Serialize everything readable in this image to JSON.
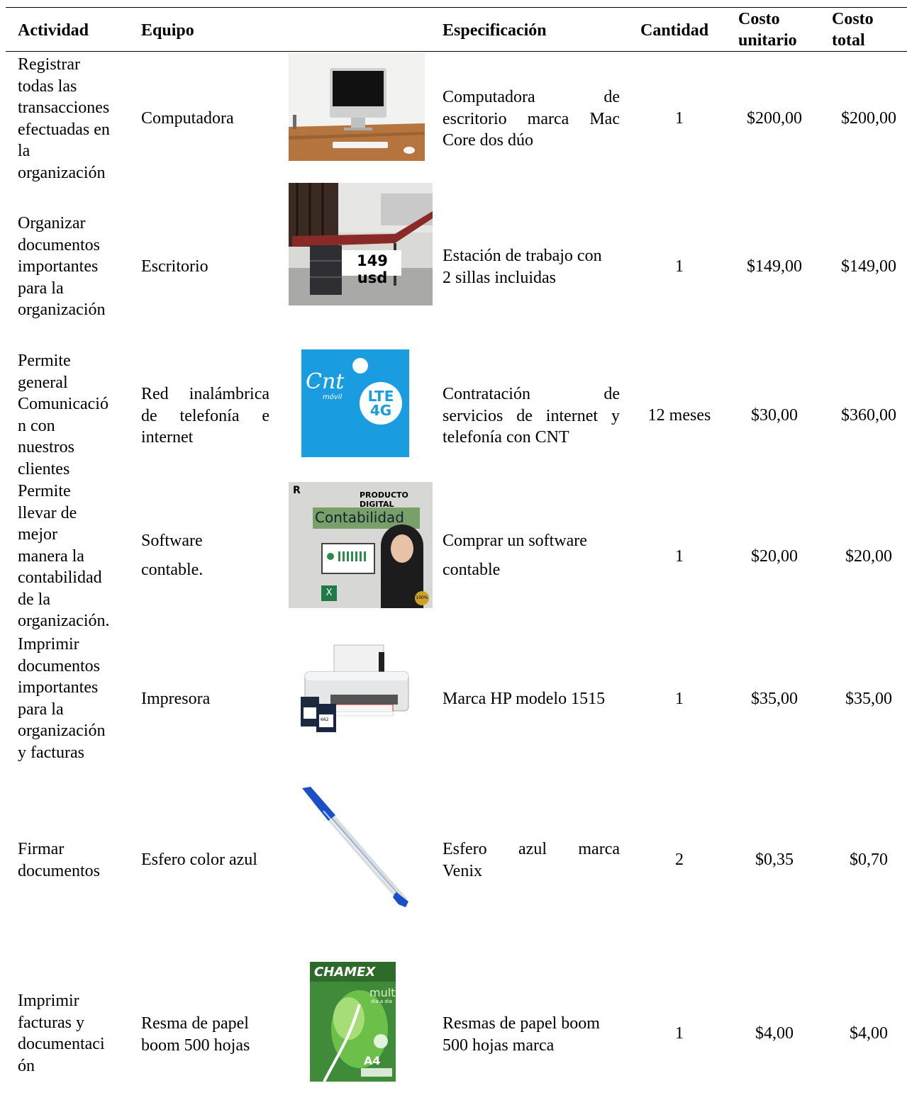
{
  "headers": {
    "actividad": "Actividad",
    "equipo": "Equipo",
    "especificacion": "Especificación",
    "cantidad": "Cantidad",
    "costo_unitario_1": "Costo",
    "costo_unitario_2": "unitario",
    "costo_total_1": "Costo",
    "costo_total_2": "total"
  },
  "rows": [
    {
      "actividad": [
        "Registrar",
        "todas las",
        "transacciones",
        "efectuadas en",
        "la",
        "organización"
      ],
      "equipo": [
        "Computadora"
      ],
      "especificacion": [
        "Computadora de",
        "escritorio marca Mac",
        "Core dos dúo"
      ],
      "cantidad": "1",
      "costo_unitario": "$200,00",
      "costo_total": "$200,00",
      "image": "imac-computer-photo"
    },
    {
      "actividad": [
        "Organizar",
        "documentos",
        "importantes",
        "para la",
        "organización"
      ],
      "equipo": [
        "Escritorio"
      ],
      "especificacion": [
        "Estación de trabajo con",
        "2 sillas incluidas"
      ],
      "cantidad": "1",
      "costo_unitario": "$149,00",
      "costo_total": "$149,00",
      "image": "desk-photo",
      "image_label": "149 usd"
    },
    {
      "actividad": [
        "Permite",
        "general",
        "Comunicació",
        "n con",
        "nuestros",
        "clientes"
      ],
      "equipo": [
        "Red inalámbrica",
        "de telefonía e",
        "internet"
      ],
      "especificacion": [
        "Contratación de",
        "servicios de internet y",
        "telefonía con CNT"
      ],
      "cantidad": "12 meses",
      "costo_unitario": "$30,00",
      "costo_total": "$360,00",
      "image": "cnt-logo",
      "image_text": {
        "brand": "Cnt",
        "sub": "móvil",
        "lte": "LTE",
        "g4": "4G"
      }
    },
    {
      "actividad": [
        "Permite",
        "llevar de",
        "mejor",
        "manera la",
        "contabilidad",
        "de la",
        "organización."
      ],
      "equipo": [
        "Software",
        "contable."
      ],
      "especificacion": [
        "Comprar un software",
        "contable"
      ],
      "cantidad": "1",
      "costo_unitario": "$20,00",
      "costo_total": "$20,00",
      "image": "accounting-software-cover",
      "image_text": {
        "top": "PRODUCTO DIGITAL",
        "title": "Contabilidad",
        "badge": "100%"
      }
    },
    {
      "actividad": [
        "Imprimir",
        "documentos",
        "importantes",
        "para la",
        "organización",
        "y facturas"
      ],
      "equipo": [
        "Impresora"
      ],
      "especificacion": [
        "Marca HP modelo 1515"
      ],
      "cantidad": "1",
      "costo_unitario": "$35,00",
      "costo_total": "$35,00",
      "image": "hp-printer-photo",
      "image_text": {
        "cart": "662"
      }
    },
    {
      "actividad": [
        "Firmar",
        "documentos"
      ],
      "equipo": [
        "Esfero color azul"
      ],
      "especificacion": [
        "Esfero azul marca",
        "Venix"
      ],
      "cantidad": "2",
      "costo_unitario": "$0,35",
      "costo_total": "$0,70",
      "image": "blue-pen-photo"
    },
    {
      "actividad": [
        "Imprimir",
        "facturas y",
        "documentaci",
        "ón"
      ],
      "equipo": [
        "Resma de papel",
        "boom 500 hojas"
      ],
      "especificacion": [
        "Resmas de papel boom",
        "500 hojas marca"
      ],
      "cantidad": "1",
      "costo_unitario": "$4,00",
      "costo_total": "$4,00",
      "image": "chamex-paper-ream",
      "image_text": {
        "brand": "CHAMEX",
        "multi": "multi",
        "sub": "dia a dia",
        "size": "A4"
      }
    }
  ]
}
